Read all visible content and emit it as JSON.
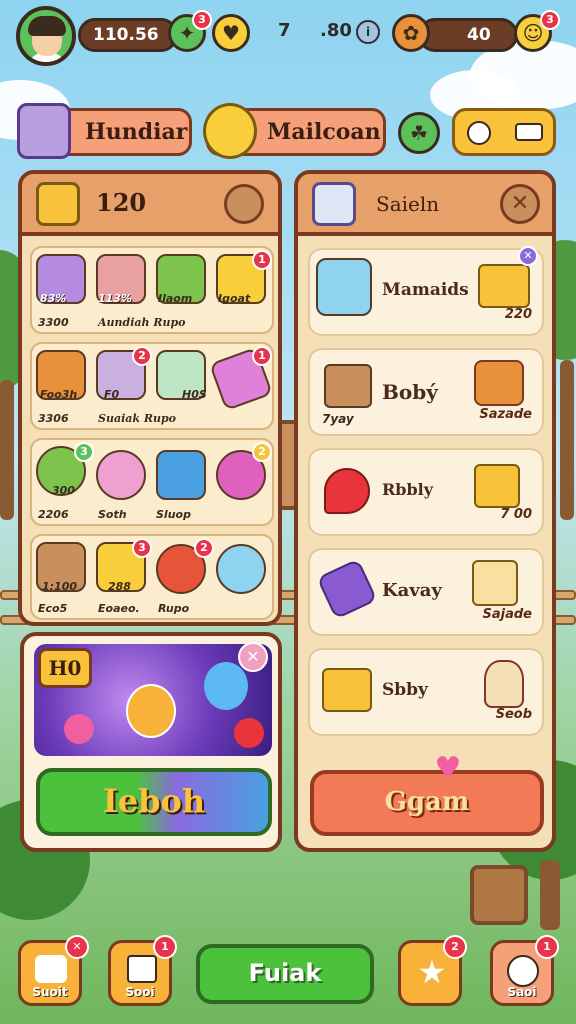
{
  "top_bar": {
    "coins": "110.56",
    "coin_badge": "3",
    "gems": "7",
    "energy": ".80",
    "tickets": "40",
    "ticket_badge": "3"
  },
  "tabs": [
    {
      "label": "Hundiar"
    },
    {
      "label": "Mailcoan"
    }
  ],
  "left_panel": {
    "header_value": "120",
    "rows": [
      {
        "values": [
          "3300",
          "Aundiah Rupo"
        ],
        "items": [
          "83%",
          "113%",
          "Ilaom",
          "Igoat"
        ],
        "item_badges": [
          "",
          "",
          "",
          "1"
        ]
      },
      {
        "values": [
          "3306",
          "Suaiak Rupo"
        ],
        "items": [
          "Foo3h",
          "F0",
          "H0S",
          ""
        ],
        "item_badges": [
          "",
          "2",
          "",
          "1"
        ]
      },
      {
        "values": [
          "2206",
          "Soth",
          "Sluop"
        ],
        "items": [
          "300",
          "",
          "",
          ""
        ],
        "item_badges": [
          "3",
          "",
          "",
          "2"
        ]
      },
      {
        "values": [
          "Eco5",
          "Eoaeo.",
          "Rupo"
        ],
        "items": [
          "1:100",
          "288",
          "",
          ""
        ],
        "item_badges": [
          "",
          "3",
          "2",
          ""
        ]
      }
    ]
  },
  "promo": {
    "value": "H0",
    "button_label": "Ieboh"
  },
  "right_panel": {
    "title": "Saieln",
    "items": [
      {
        "label": "Mamaids",
        "price": "220"
      },
      {
        "label": "Bobý",
        "price": "Sazade"
      },
      {
        "label": "Rbbly",
        "price": "7 00"
      },
      {
        "label": "Kavay",
        "price": "Sajade"
      },
      {
        "label": "Sbby",
        "price": "Seob"
      }
    ],
    "left_tags": [
      "",
      "7yay",
      "",
      "",
      ""
    ],
    "button_label": "Ggam"
  },
  "bottom_bar": {
    "btn1": {
      "label": "Suoit"
    },
    "btn2": {
      "label": "Sooi",
      "badge": "1"
    },
    "main": {
      "label": "Fuiak"
    },
    "btn4": {
      "badge": "2"
    },
    "btn5": {
      "label": "Saoi",
      "badge": "1"
    }
  },
  "colors": {
    "wood": "#7a3a22",
    "panel": "#f4dfb6",
    "green_btn": "#4cc23c",
    "orange_btn": "#f27a56",
    "badge": "#e8344a"
  }
}
